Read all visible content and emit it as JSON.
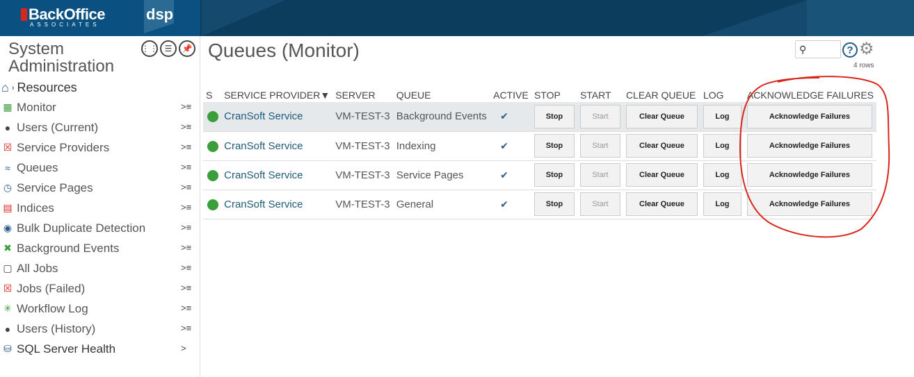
{
  "header": {
    "brand": "BackOffice",
    "brand_sub": "ASSOCIATES",
    "product": "dsp"
  },
  "sidebar": {
    "title_line1": "System",
    "title_line2": "Administration",
    "breadcrumb": "Resources",
    "items": [
      {
        "label": "Monitor",
        "icon": "monitor-icon"
      },
      {
        "label": "Users (Current)",
        "icon": "user-icon"
      },
      {
        "label": "Service Providers",
        "icon": "service-providers-icon"
      },
      {
        "label": "Queues",
        "icon": "queues-icon"
      },
      {
        "label": "Service Pages",
        "icon": "clock-icon"
      },
      {
        "label": "Indices",
        "icon": "indices-icon"
      },
      {
        "label": "Bulk Duplicate Detection",
        "icon": "duplicate-icon"
      },
      {
        "label": "Background Events",
        "icon": "tools-icon"
      },
      {
        "label": "All Jobs",
        "icon": "clipboard-icon"
      },
      {
        "label": "Jobs (Failed)",
        "icon": "failed-jobs-icon"
      },
      {
        "label": "Workflow Log",
        "icon": "workflow-icon"
      },
      {
        "label": "Users (History)",
        "icon": "user-history-icon"
      },
      {
        "label": "SQL Server Health",
        "icon": "database-icon"
      }
    ]
  },
  "main": {
    "title": "Queues (Monitor)",
    "rows_count": "4 rows",
    "search_placeholder": "",
    "columns": [
      "S",
      "SERVICE PROVIDER▼",
      "SERVER",
      "QUEUE",
      "ACTIVE",
      "STOP",
      "START",
      "CLEAR QUEUE",
      "LOG",
      "ACKNOWLEDGE FAILURES"
    ],
    "rows": [
      {
        "provider": "CranSoft Service",
        "server": "VM-TEST-3",
        "queue": "Background Events",
        "active": "✔"
      },
      {
        "provider": "CranSoft Service",
        "server": "VM-TEST-3",
        "queue": "Indexing",
        "active": "✔"
      },
      {
        "provider": "CranSoft Service",
        "server": "VM-TEST-3",
        "queue": "Service Pages",
        "active": "✔"
      },
      {
        "provider": "CranSoft Service",
        "server": "VM-TEST-3",
        "queue": "General",
        "active": "✔"
      }
    ],
    "buttons": {
      "stop": "Stop",
      "start": "Start",
      "clear": "Clear Queue",
      "log": "Log",
      "ack": "Acknowledge Failures"
    }
  },
  "colors": {
    "header_bg": "#0d3d5c",
    "status_ok": "#3a9e3a",
    "annotation": "#d9261c"
  }
}
